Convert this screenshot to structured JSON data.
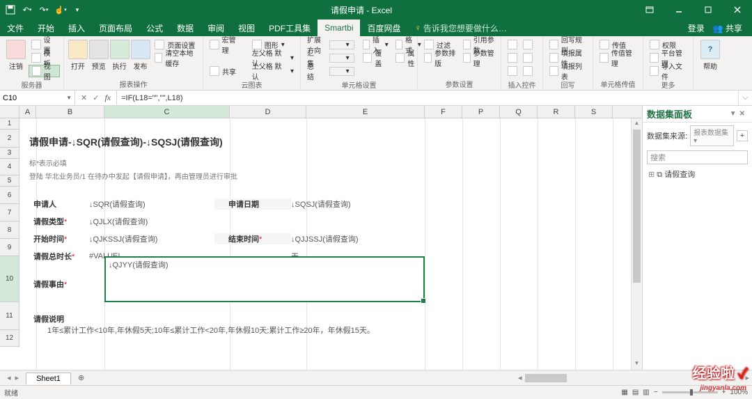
{
  "title": "请假申请 - Excel",
  "qa": [
    "save",
    "undo",
    "redo",
    "touch"
  ],
  "tabs": [
    "文件",
    "开始",
    "插入",
    "页面布局",
    "公式",
    "数据",
    "审阅",
    "视图",
    "PDF工具集",
    "Smartbi",
    "百度网盘"
  ],
  "active_tab": 9,
  "tell_me": "告诉我您想要做什么…",
  "signin": "登录",
  "share": "共享",
  "ribbon": {
    "g_server": {
      "label": "服务器",
      "big": "注销",
      "side": [
        "设置",
        "模板",
        "视图"
      ]
    },
    "g_report": {
      "label": "报表操作",
      "b1": "打开",
      "b2": "预览",
      "b3": "执行",
      "b4": "发布",
      "side": [
        "页面设置",
        "清空本地缓存"
      ]
    },
    "g_cloud": {
      "label": "云图表",
      "side": [
        "宏管理",
        "共享"
      ],
      "shape": [
        "图形",
        "左父格 默认",
        "上父格 默认"
      ]
    },
    "g_cell": {
      "label": "单元格设置",
      "ext": "扩展方向",
      "hj": "汇集",
      "zj": "总结",
      "ins": "插入",
      "cover": "覆盖",
      "gs": "格式",
      "attr": "属性"
    },
    "g_param": {
      "label": "参数设置",
      "f": "过滤",
      "sort": "参数排版",
      "yin": "引用参数",
      "mgr": "参数管理"
    },
    "g_ins": {
      "label": "插入控件"
    },
    "g_hx": {
      "label": "回写",
      "a": "回写规则",
      "b": "填报属性",
      "c": "填报列表"
    },
    "g_cv": {
      "label": "单元格传值",
      "a": "传值",
      "b": "传值管理"
    },
    "g_more": {
      "label": "更多",
      "a": "权限",
      "b": "平台管理",
      "c": "导入文件",
      "help": "帮助"
    }
  },
  "namebox": "C10",
  "formula": "=IF(L18=\"\",\"\",L18)",
  "cols": [
    "A",
    "B",
    "C",
    "D",
    "E",
    "F",
    "P",
    "Q",
    "R",
    "S"
  ],
  "rows_h": [
    1,
    2,
    3,
    4,
    5,
    6,
    7,
    8,
    9,
    10,
    11,
    12
  ],
  "form": {
    "title": "请假申请-↓SQR(请假查询)-↓SQSJ(请假查询)",
    "hint1": "标*表示必填",
    "hint2": "登陆 华北业务员/1 在待办中发起【请假申请】，再由管理员进行审批",
    "l_apply": "申请人",
    "v_apply": "↓SQR(请假查询)",
    "l_date": "申请日期",
    "v_date": "↓SQSJ(请假查询)",
    "l_type": "请假类型",
    "v_type": "↓QJLX(请假查询)",
    "l_start": "开始时间",
    "v_start": "↓QJKSSJ(请假查询)",
    "l_end": "结束时间",
    "v_end": "↓QJJSSJ(请假查询)",
    "l_total": "请假总时长",
    "v_total": "#VALUE!",
    "unit": "天",
    "l_reason": "请假事由",
    "v_reason": "↓QJYY(请假查询)",
    "l_note": "请假说明",
    "note_text": "1年≤累计工作<10年,年休假5天;10年≤累计工作<20年,年休假10天;累计工作≥20年，年休假15天。"
  },
  "panel": {
    "title": "数据集面板",
    "src_label": "数据集来源:",
    "src_value": "报表数据集",
    "search": "搜索",
    "tree_item": "请假查询"
  },
  "sheet": {
    "tab": "Sheet1"
  },
  "status": {
    "ready": "就绪",
    "zoom": "100%"
  },
  "watermark": "经验啦",
  "watermark_sub": "jingyanla.com"
}
